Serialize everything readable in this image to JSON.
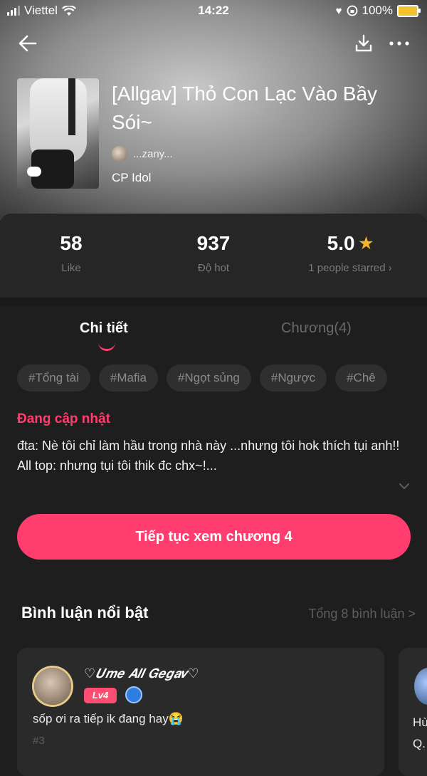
{
  "status_bar": {
    "carrier": "Viettel",
    "time": "14:22",
    "battery": "100%"
  },
  "book": {
    "title": "[Allgav] Thỏ Con Lạc Vào Bầy Sói~",
    "author": "...zany...",
    "category": "CP Idol"
  },
  "stats": [
    {
      "value": "58",
      "label": "Like"
    },
    {
      "value": "937",
      "label": "Độ hot"
    },
    {
      "value": "5.0",
      "label": "1 people starred"
    }
  ],
  "tabs": {
    "detail": "Chi tiết",
    "chapters": "Chương(4)"
  },
  "tags": [
    "#Tổng tài",
    "#Mafia",
    "#Ngọt sủng",
    "#Ngược",
    "#Chê"
  ],
  "update_status": "Đang cập nhật",
  "description": {
    "line1": "đta: Nè tôi chỉ làm hầu trong nhà này ...nhưng tôi hok thích tụi anh!!",
    "line2": "All top: nhưng tụi tôi thik đc chx~!..."
  },
  "continue_button": "Tiếp tục xem chương 4",
  "comments_section": {
    "title": "Bình luận nổi bật",
    "total": "Tổng 8 bình luận >"
  },
  "comments": [
    {
      "user": "♡𝑼𝒎𝒆 𝑨𝒍𝒍 𝑮𝒆𝒈𝒂𝒗♡",
      "level": "Lv4",
      "text": "sốp ơi ra tiếp ik đang hay😭",
      "floor": "#3"
    },
    {
      "text_line1": "Hù",
      "text_line2": "Q."
    }
  ],
  "colors": {
    "accent": "#ff3d6e",
    "star": "#f5b32e"
  }
}
